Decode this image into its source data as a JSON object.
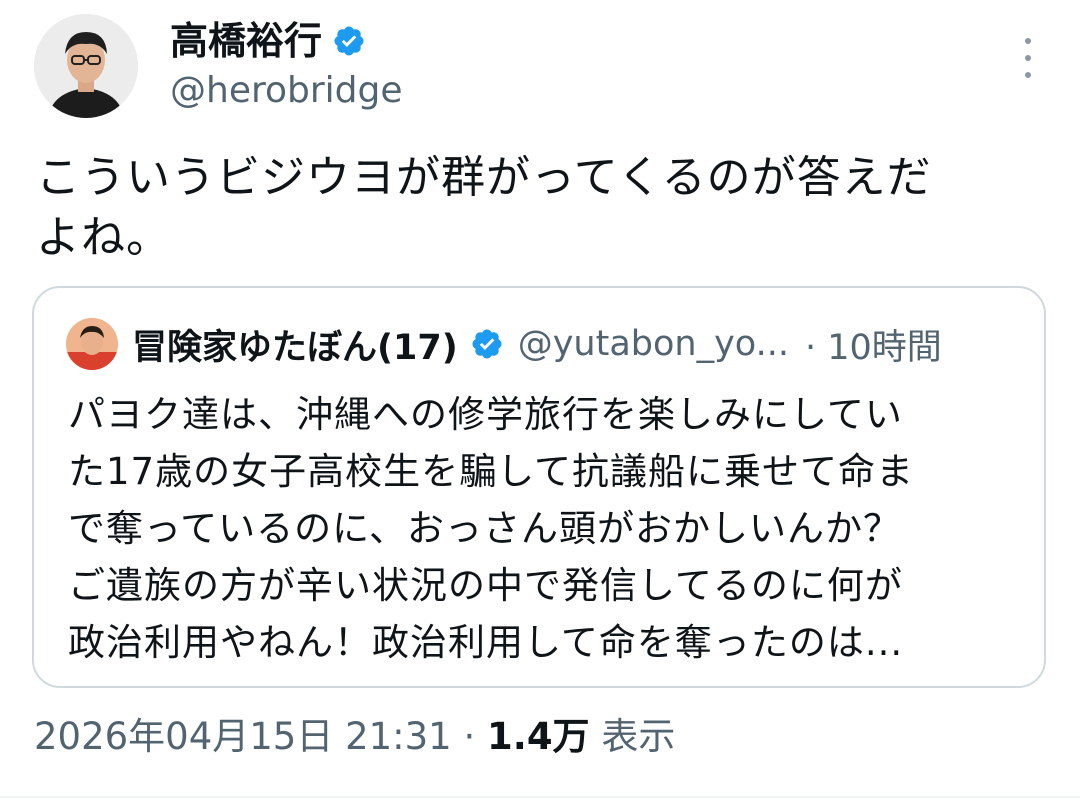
{
  "author": {
    "name": "高橋裕行",
    "handle": "@herobridge",
    "verified": true
  },
  "tweet": {
    "text_line1": "こういうビジウヨが群がってくるのが答えだ",
    "text_line2": "よね。"
  },
  "quote": {
    "name": "冒険家ゆたぼん(17)",
    "handle": "@yutabon_yo...",
    "time": "· 10時間",
    "verified": true,
    "lines": [
      "パヨク達は、沖縄への修学旅行を楽しみにしてい",
      "た17歳の女子高校生を騙して抗議船に乗せて命ま",
      "で奪っているのに、おっさん頭がおかしいんか？",
      "ご遺族の方が辛い状況の中で発信してるのに何が",
      "政治利用やねん！政治利用して命を奪ったのは..."
    ]
  },
  "meta": {
    "timestamp": "2026年04月15日 21:31",
    "separator": " · ",
    "views_count": "1.4万",
    "views_label": " 表示"
  },
  "colors": {
    "verified_blue": "#1d9bf0",
    "secondary_text": "#536471",
    "border": "#cfd9de"
  },
  "icons": {
    "verified": "verified-badge-icon",
    "more": "more-dots-icon"
  }
}
